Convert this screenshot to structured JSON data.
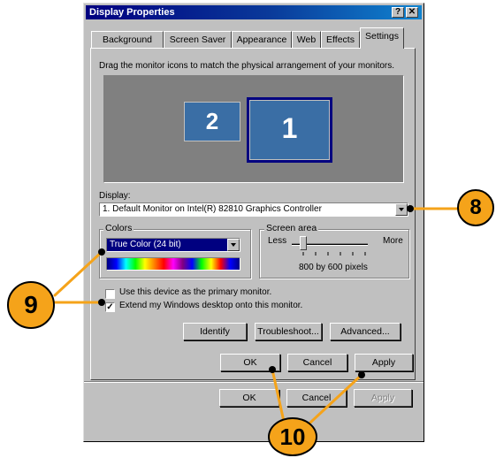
{
  "window": {
    "title": "Display Properties",
    "help_btn": "?",
    "close_btn": "✕"
  },
  "tabs": [
    "Background",
    "Screen Saver",
    "Appearance",
    "Web",
    "Effects",
    "Settings"
  ],
  "settings": {
    "instruction": "Drag the monitor icons to match the physical arrangement of your monitors.",
    "monitor_2": "2",
    "monitor_1": "1",
    "display_label": "Display:",
    "display_value": "1. Default Monitor on Intel(R) 82810 Graphics Controller",
    "colors_label": "Colors",
    "colors_value": "True Color (24 bit)",
    "screen_area_label": "Screen area",
    "screen_less": "Less",
    "screen_more": "More",
    "screen_value": "800 by 600 pixels",
    "primary_checkbox": "Use this device as the primary monitor.",
    "primary_checked": false,
    "extend_checkbox": "Extend my Windows desktop onto this monitor.",
    "extend_checked": true,
    "identify_btn": "Identify",
    "troubleshoot_btn": "Troubleshoot...",
    "advanced_btn": "Advanced..."
  },
  "buttons_inner": {
    "ok": "OK",
    "cancel": "Cancel",
    "apply": "Apply"
  },
  "buttons_outer": {
    "ok": "OK",
    "cancel": "Cancel",
    "apply": "Apply"
  },
  "callouts": {
    "c8": "8",
    "c9": "9",
    "c10": "10"
  },
  "colors": {
    "callout": "#f5a31a",
    "titlebar": "#000080",
    "monitor_bg": "#808080",
    "monitor_tile": "#3a6ea5"
  }
}
